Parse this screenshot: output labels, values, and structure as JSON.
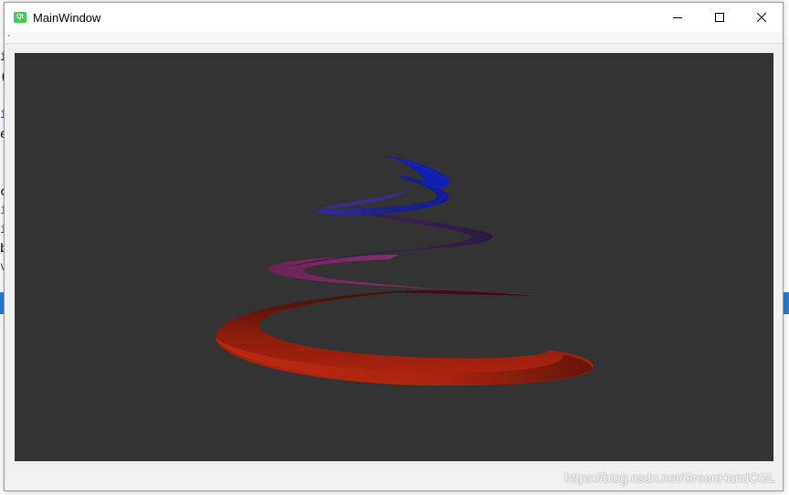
{
  "window": {
    "title": "MainWindow",
    "app_icon_text": "Qt",
    "app_icon_color": "#41cd52",
    "minimize_icon": "minimize-icon",
    "maximize_icon": "maximize-icon",
    "close_icon": "close-icon"
  },
  "viewport": {
    "background": "#333333",
    "object": "helix-ribbon",
    "colors": {
      "top": "#1a2ad0",
      "middle": "#8a2a6a",
      "bottom": "#b02510"
    }
  },
  "statusbar": {
    "watermark": "https://blog.csdn.net/GreenHandCGL"
  },
  "background_editor": {
    "fragments": [
      "i",
      "(",
      "i",
      "e",
      "c",
      "i",
      "i",
      "b",
      "v"
    ]
  }
}
